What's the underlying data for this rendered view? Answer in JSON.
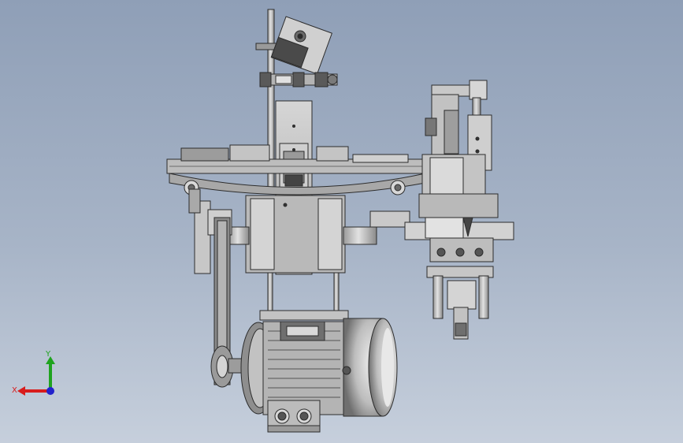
{
  "viewport": {
    "background_top": "#8f9fb7",
    "background_bottom": "#c6cfdc"
  },
  "part_colors": {
    "steel": "#c9c9c9",
    "steel_dark": "#8e8e8e",
    "outline": "#2c2c2c",
    "dark_block": "#5b5b5b",
    "motor_body": "#bdbdbd"
  },
  "triad": {
    "x_label": "X",
    "y_label": "Y",
    "x_color": "#d81c1c",
    "y_color": "#1fa31f",
    "origin_color": "#2222cc"
  },
  "icons": [
    "coordinate-triad-icon"
  ]
}
